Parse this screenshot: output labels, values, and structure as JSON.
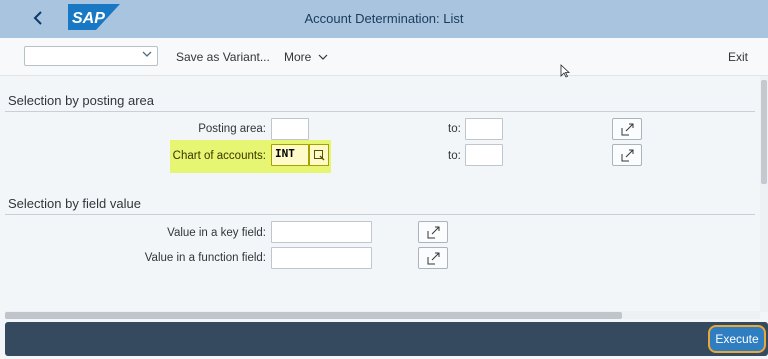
{
  "shell": {
    "back_icon": "chevron-left-icon",
    "logo_text": "SAP",
    "title": "Account Determination: List"
  },
  "toolbar": {
    "variant_value": "",
    "save_variant_label": "Save as Variant...",
    "more_label": "More",
    "exit_label": "Exit"
  },
  "sections": {
    "posting_area": {
      "title": "Selection by posting area",
      "rows": [
        {
          "label": "Posting area:",
          "from": "",
          "to_label": "to:",
          "to": ""
        },
        {
          "label": "Chart of accounts:",
          "from": "INT",
          "to_label": "to:",
          "to": ""
        }
      ]
    },
    "field_value": {
      "title": "Selection by field value",
      "rows": [
        {
          "label": "Value in a key field:",
          "value": ""
        },
        {
          "label": "Value in a function field:",
          "value": ""
        }
      ]
    }
  },
  "footer": {
    "execute_label": "Execute"
  },
  "colors": {
    "shell_bg": "#a9c4de",
    "highlight": "#e6f572",
    "footer_bg": "#354a5f",
    "execute_bg": "#2f7ec1",
    "execute_outline": "#e8a83a"
  }
}
